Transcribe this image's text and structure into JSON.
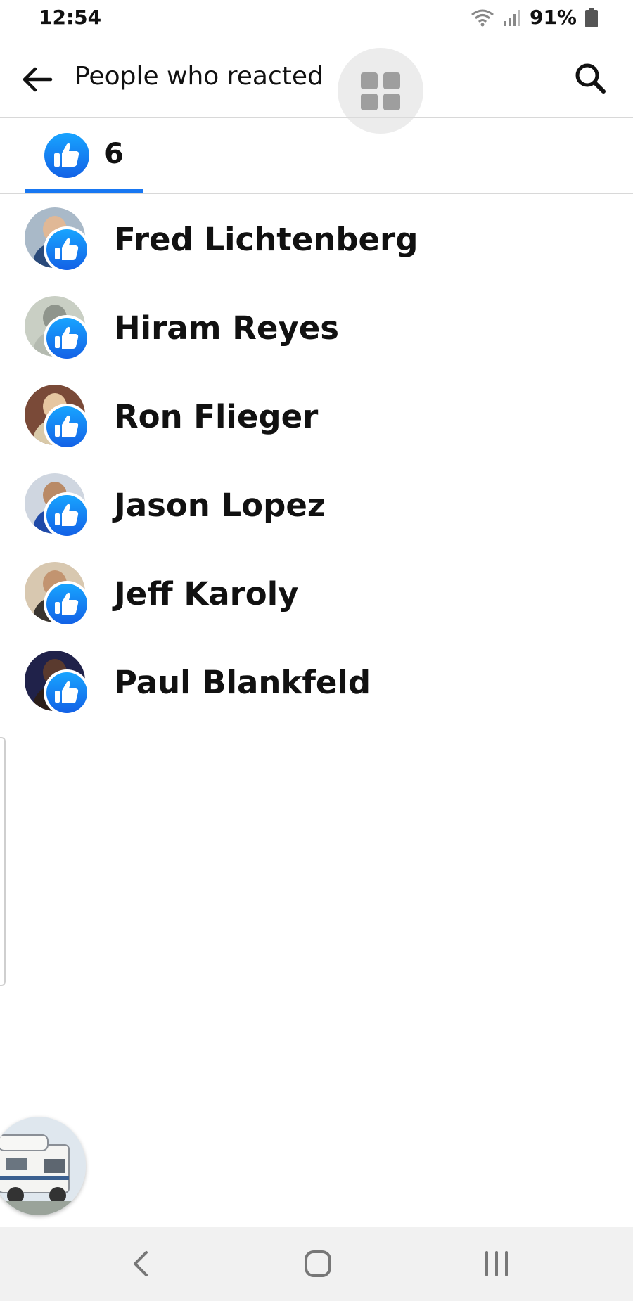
{
  "status_bar": {
    "time": "12:54",
    "battery": "91%"
  },
  "header": {
    "title": "People who reacted"
  },
  "tabs": [
    {
      "reaction": "like",
      "count": "6"
    }
  ],
  "reactions": [
    {
      "name": "Fred Lichtenberg",
      "reaction": "like"
    },
    {
      "name": "Hiram Reyes",
      "reaction": "like"
    },
    {
      "name": "Ron Flieger",
      "reaction": "like"
    },
    {
      "name": "Jason Lopez",
      "reaction": "like"
    },
    {
      "name": "Jeff Karoly",
      "reaction": "like"
    },
    {
      "name": "Paul Blankfeld",
      "reaction": "like"
    }
  ],
  "colors": {
    "accent": "#1877f2",
    "divider": "#d8d8d8",
    "nav_bg": "#f1f1f1"
  },
  "icons": [
    "back-arrow-icon",
    "grid-icon",
    "search-icon",
    "like-icon",
    "wifi-icon",
    "signal-icon",
    "battery-icon"
  ]
}
